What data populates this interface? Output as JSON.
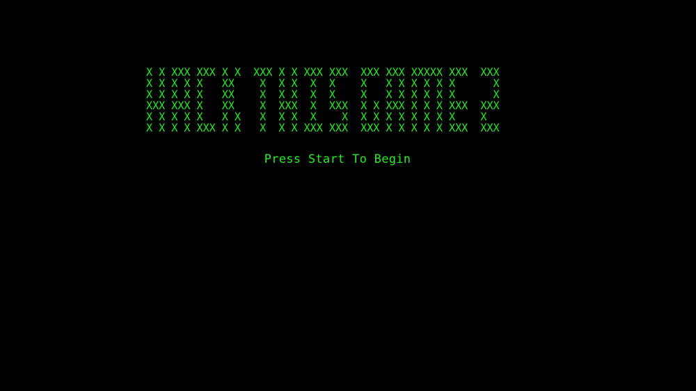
{
  "title_art": {
    "lines": [
      "X X XXX XXX X X  XXX X X XXX XXX  XXX XXX XXXXX XXX  XXX",
      "X X X X X   XX    X  X X  X  X    X   X X X X X X      X",
      "X X X X X   XX    X  X X  X  X    X   X X X X X X      X",
      "XXX XXX X   XX    X  XXX  X  XXX  X X XXX X X X XXX  XXX",
      "X X X X X   X X   X  X X  X    X  X X X X X X X X    X",
      "X X X X XXX X X   X  X X XXX XXX  XXX X X X X X XXX  XXX"
    ]
  },
  "prompt": {
    "label": "Press Start To Begin"
  },
  "colors": {
    "background": "#000000",
    "text": "#22ee22"
  }
}
